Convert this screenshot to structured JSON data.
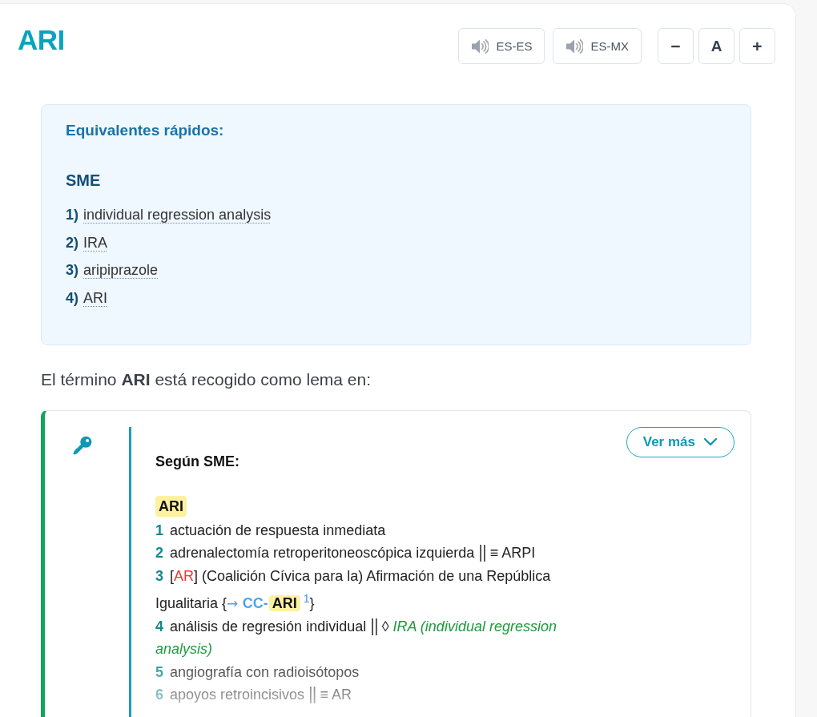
{
  "header": {
    "title": "ARI",
    "voice_buttons": [
      {
        "label": "ES-ES"
      },
      {
        "label": "ES-MX"
      }
    ],
    "font_controls": [
      {
        "kind": "decrease",
        "label": "−"
      },
      {
        "kind": "reset",
        "label": "A"
      },
      {
        "kind": "increase",
        "label": "+"
      }
    ]
  },
  "quick_equivalents": {
    "heading": "Equivalentes rápidos:",
    "source": "SME",
    "items": [
      {
        "number": "1)",
        "term": "individual regression analysis"
      },
      {
        "number": "2)",
        "term": "IRA"
      },
      {
        "number": "3)",
        "term": "aripiprazole"
      },
      {
        "number": "4)",
        "term": "ARI"
      }
    ]
  },
  "lemma_intro": "El término **ARI** está recogido como lema en:",
  "sources": [
    {
      "heading": "Según SME:",
      "expanded": false,
      "toggle_label": "Ver más",
      "headword": "ARI",
      "senses": [
        {
          "number": "1",
          "segments": [
            {
              "kind": "text",
              "text": "actuación de respuesta inmediata"
            }
          ]
        },
        {
          "number": "2",
          "segments": [
            {
              "kind": "text",
              "text": "adrenalectomía retroperitoneoscópica izquierda "
            },
            {
              "kind": "separator",
              "text": "||"
            },
            {
              "kind": "text",
              "text": " ≡ ARPI"
            }
          ]
        },
        {
          "number": "3",
          "segments": [
            {
              "kind": "text",
              "text": "["
            },
            {
              "kind": "abbr",
              "text": "AR"
            },
            {
              "kind": "text",
              "text": "] (Coalición Cívica para la) Afirmación de una República Igualitaria {"
            },
            {
              "kind": "arrow",
              "text": "→ "
            },
            {
              "kind": "xref",
              "prefix": "CC-",
              "match": "ARI"
            },
            {
              "kind": "note",
              "text": "1"
            },
            {
              "kind": "text",
              "text": "}"
            }
          ]
        },
        {
          "number": "4",
          "segments": [
            {
              "kind": "text",
              "text": "análisis de regresión individual "
            },
            {
              "kind": "separator",
              "text": "||"
            },
            {
              "kind": "text",
              "text": " ◊ "
            },
            {
              "kind": "variant",
              "text": "IRA (individual regression analysis)"
            }
          ]
        },
        {
          "number": "5",
          "segments": [
            {
              "kind": "text",
              "text": "angiografía con radioisótopos"
            }
          ]
        },
        {
          "number": "6",
          "segments": [
            {
              "kind": "text",
              "text": "apoyos retroincisivos "
            },
            {
              "kind": "separator",
              "text": "||"
            },
            {
              "kind": "text",
              "text": " ≡ AR"
            }
          ]
        }
      ]
    }
  ]
}
